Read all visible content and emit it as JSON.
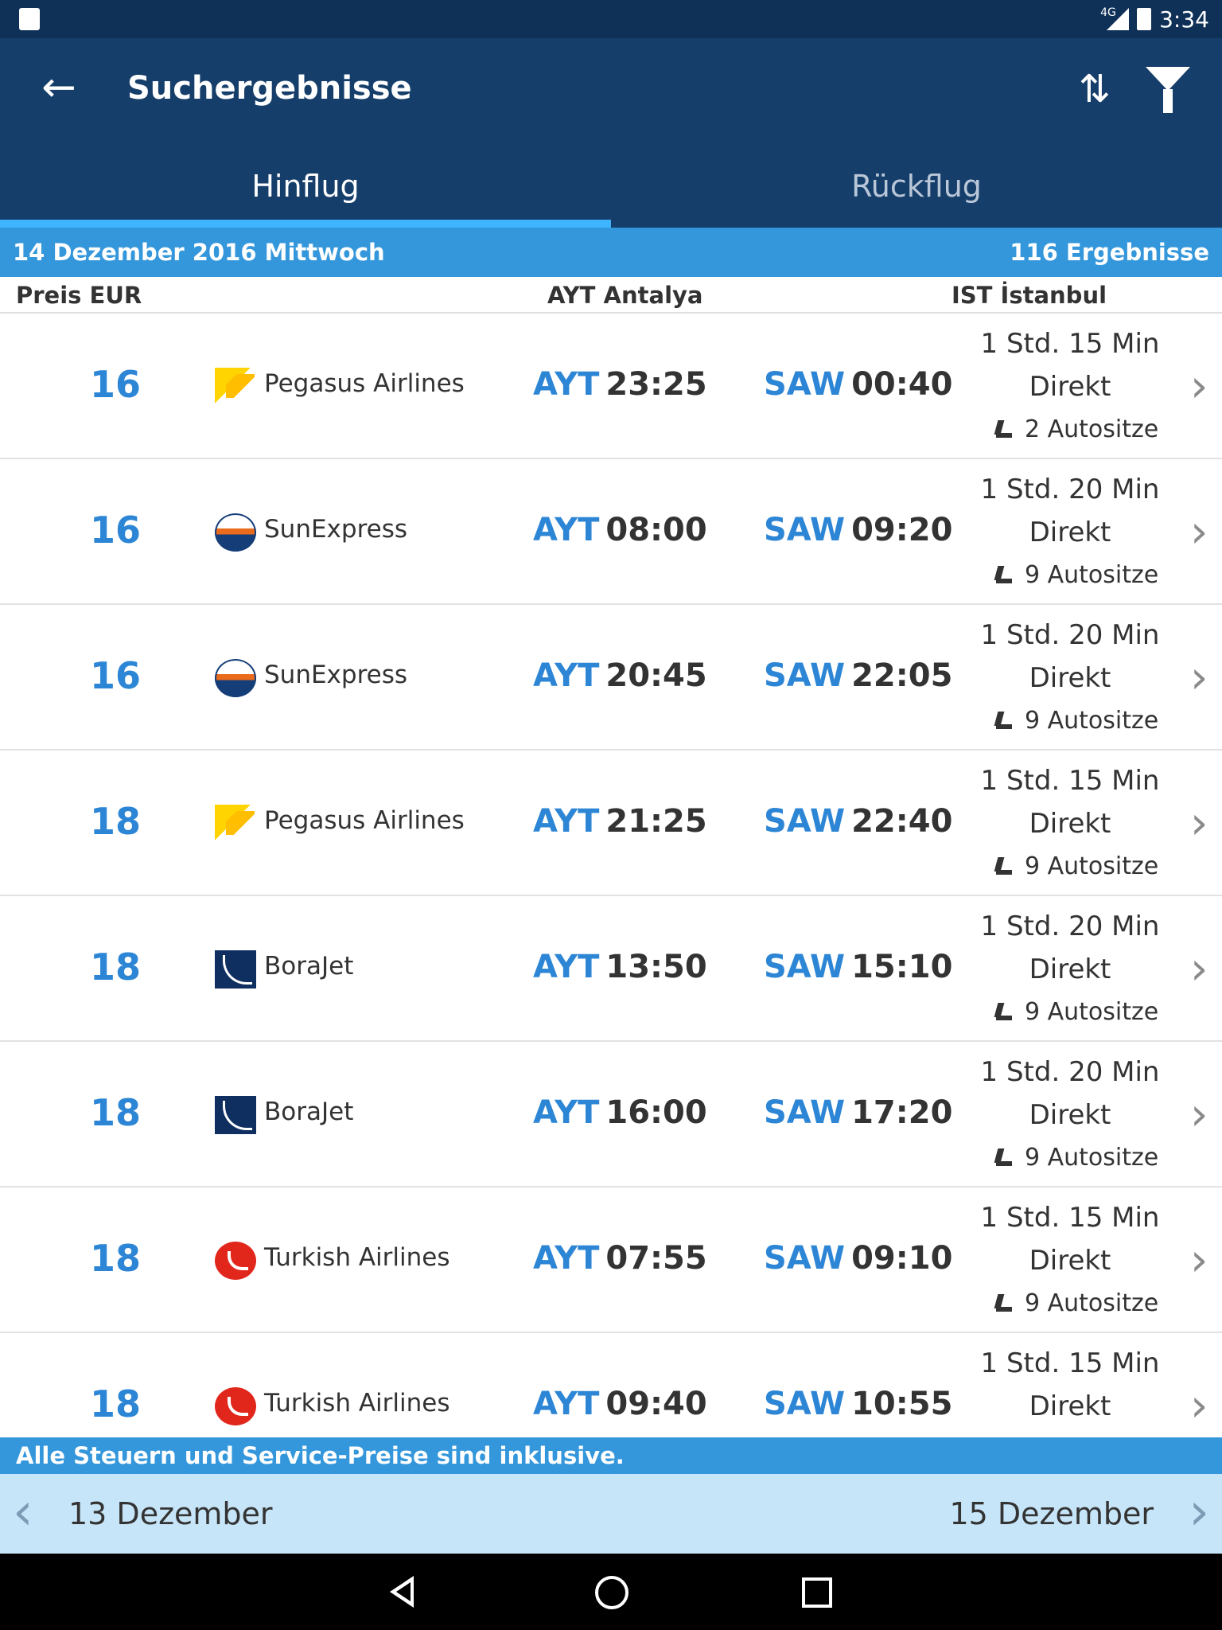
{
  "status_bar": {
    "time": "3:34",
    "network": "4G"
  },
  "app_bar": {
    "title": "Suchergebnisse"
  },
  "tabs": [
    {
      "label": "Hinflug",
      "active": true
    },
    {
      "label": "Rückflug",
      "active": false
    }
  ],
  "date_bar": {
    "date": "14 Dezember 2016 Mittwoch",
    "results": "116 Ergebnisse"
  },
  "columns": {
    "price": "Preis EUR",
    "origin": "AYT Antalya",
    "destination": "IST İstanbul"
  },
  "flights": [
    {
      "price": "16",
      "airline": "Pegasus Airlines",
      "logo": "pegasus-logo-icon",
      "dep_code": "AYT",
      "dep_time": "23:25",
      "arr_code": "SAW",
      "arr_time": "00:40",
      "duration": "1 Std. 15 Min",
      "stops": "Direkt",
      "seats": "2 Autositze"
    },
    {
      "price": "16",
      "airline": "SunExpress",
      "logo": "sunexpress-logo-icon",
      "dep_code": "AYT",
      "dep_time": "08:00",
      "arr_code": "SAW",
      "arr_time": "09:20",
      "duration": "1 Std. 20 Min",
      "stops": "Direkt",
      "seats": "9 Autositze"
    },
    {
      "price": "16",
      "airline": "SunExpress",
      "logo": "sunexpress-logo-icon",
      "dep_code": "AYT",
      "dep_time": "20:45",
      "arr_code": "SAW",
      "arr_time": "22:05",
      "duration": "1 Std. 20 Min",
      "stops": "Direkt",
      "seats": "9 Autositze"
    },
    {
      "price": "18",
      "airline": "Pegasus Airlines",
      "logo": "pegasus-logo-icon",
      "dep_code": "AYT",
      "dep_time": "21:25",
      "arr_code": "SAW",
      "arr_time": "22:40",
      "duration": "1 Std. 15 Min",
      "stops": "Direkt",
      "seats": "9 Autositze"
    },
    {
      "price": "18",
      "airline": "BoraJet",
      "logo": "borajet-logo-icon",
      "dep_code": "AYT",
      "dep_time": "13:50",
      "arr_code": "SAW",
      "arr_time": "15:10",
      "duration": "1 Std. 20 Min",
      "stops": "Direkt",
      "seats": "9 Autositze"
    },
    {
      "price": "18",
      "airline": "BoraJet",
      "logo": "borajet-logo-icon",
      "dep_code": "AYT",
      "dep_time": "16:00",
      "arr_code": "SAW",
      "arr_time": "17:20",
      "duration": "1 Std. 20 Min",
      "stops": "Direkt",
      "seats": "9 Autositze"
    },
    {
      "price": "18",
      "airline": "Turkish Airlines",
      "logo": "turkish-airlines-logo-icon",
      "dep_code": "AYT",
      "dep_time": "07:55",
      "arr_code": "SAW",
      "arr_time": "09:10",
      "duration": "1 Std. 15 Min",
      "stops": "Direkt",
      "seats": "9 Autositze"
    },
    {
      "price": "18",
      "airline": "Turkish Airlines",
      "logo": "turkish-airlines-logo-icon",
      "dep_code": "AYT",
      "dep_time": "09:40",
      "arr_code": "SAW",
      "arr_time": "10:55",
      "duration": "1 Std. 15 Min",
      "stops": "Direkt",
      "seats": ""
    }
  ],
  "footer": {
    "taxes": "Alle Steuern und Service-Preise sind inklusive."
  },
  "date_nav": {
    "prev": "13 Dezember",
    "next": "15 Dezember"
  },
  "icons": {
    "back": "arrow-left-icon",
    "sort": "sort-icon",
    "filter": "filter-icon",
    "seat": "seat-icon",
    "chevron": "chevron-right-icon"
  },
  "colors": {
    "primary": "#163e6a",
    "accent": "#3497db",
    "price": "#2d86d5"
  }
}
